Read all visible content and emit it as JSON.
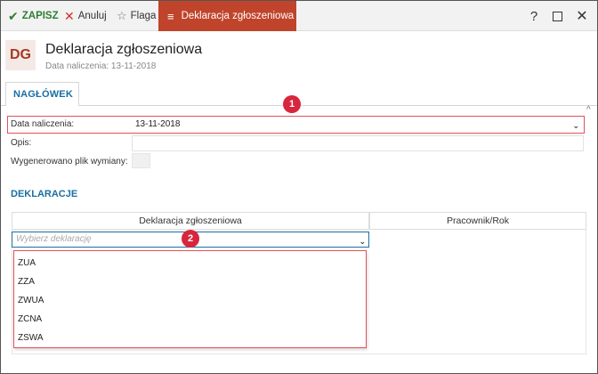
{
  "toolbar": {
    "save_label": "ZAPISZ",
    "cancel_label": "Anuluj",
    "flag_label": "Flaga",
    "active_tab_label": "Deklaracja zgłoszeniowa",
    "help_label": "?"
  },
  "header": {
    "badge": "DG",
    "title": "Deklaracja zgłoszeniowa",
    "subtitle": "Data naliczenia: 13-11-2018"
  },
  "tabs": [
    {
      "label": "NAGŁÓWEK"
    }
  ],
  "form": {
    "date_label": "Data naliczenia:",
    "date_value": "13-11-2018",
    "desc_label": "Opis:",
    "desc_value": "",
    "generated_label": "Wygenerowano plik wymiany:"
  },
  "section_title": "DEKLARACJE",
  "grid": {
    "columns": [
      "Deklaracja zgłoszeniowa",
      "Pracownik/Rok"
    ],
    "combo_placeholder": "Wybierz deklarację",
    "options": [
      "ZUA",
      "ZZA",
      "ZWUA",
      "ZCNA",
      "ZSWA"
    ]
  },
  "annotations": [
    "1",
    "2"
  ],
  "colors": {
    "accent": "#c0442b",
    "link_blue": "#1a6fa3",
    "save_green": "#2e7d32",
    "highlight_red": "#e0525b"
  }
}
